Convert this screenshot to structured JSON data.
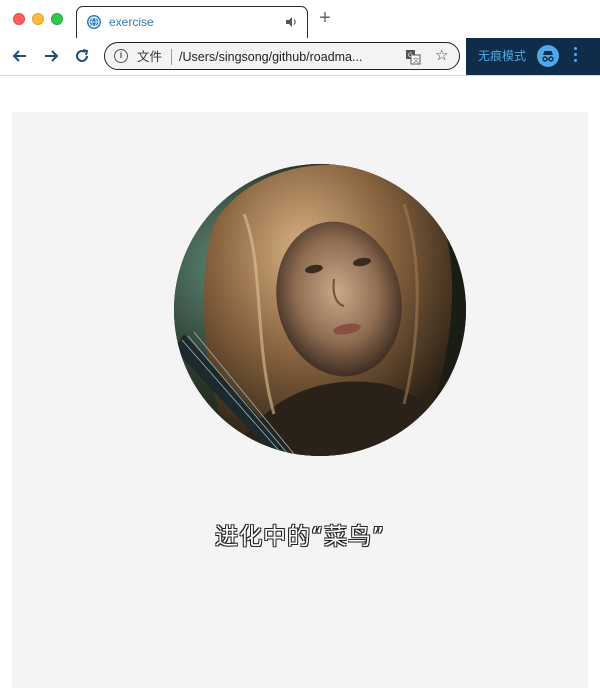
{
  "browser": {
    "tab": {
      "title": "exercise",
      "audio_icon": "speaker-icon"
    },
    "new_tab_icon": "plus-icon",
    "toolbar": {
      "back_icon": "arrow-left-icon",
      "forward_icon": "arrow-right-icon",
      "reload_icon": "reload-icon"
    },
    "omnibox": {
      "security_label": "文件",
      "url": "/Users/singsong/github/roadma...",
      "translate_icon": "translate-icon",
      "bookmark_icon": "star-icon"
    },
    "incognito": {
      "label": "无痕模式",
      "icon": "incognito-icon",
      "menu_icon": "more-vert-icon"
    }
  },
  "page": {
    "avatar_icon": "portrait-photo",
    "caption": "进化中的“菜鸟”"
  },
  "colors": {
    "tab_accent": "#2e7cb8",
    "incognito_bg": "#0f2c4a",
    "incognito_accent": "#4fa9e8",
    "card_bg": "#f4f4f4"
  }
}
